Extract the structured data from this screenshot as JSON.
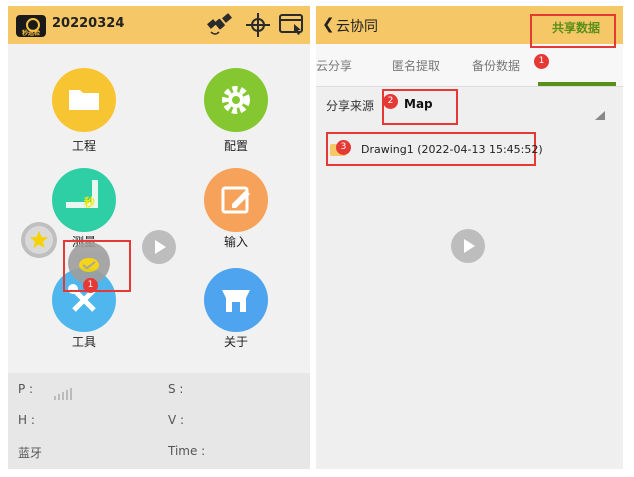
{
  "left": {
    "header": {
      "logo_text": "秒巡检",
      "project_name": "20220324",
      "icons": [
        "satellite-icon",
        "crosshair-icon",
        "screen-touch-icon"
      ]
    },
    "menu": [
      {
        "label": "工程",
        "icon": "folder-icon",
        "color": "#f7c531"
      },
      {
        "label": "配置",
        "icon": "gear-icon",
        "color": "#85c730"
      },
      {
        "label": "测量",
        "icon": "measure-icon",
        "color": "#2ecfa4"
      },
      {
        "label": "输入",
        "icon": "edit-icon",
        "color": "#f6a25a"
      },
      {
        "label": "工具",
        "icon": "tools-icon",
        "color": "#4fb7ee"
      },
      {
        "label": "关于",
        "icon": "about-icon",
        "color": "#4ea4ee"
      }
    ],
    "floating": {
      "star_icon": "star-icon",
      "cloud_icon": "cloud-icon",
      "play_icon": "play-icon",
      "badge": "1",
      "measure_badge": "秒"
    },
    "status": {
      "p_label": "P :",
      "s_label": "S :",
      "h_label": "H :",
      "v_label": "V :",
      "bt_label": "蓝牙",
      "time_label": "Time :"
    }
  },
  "right": {
    "header": {
      "back_icon": "chevron-left-icon",
      "title": "云协同"
    },
    "tabs": [
      "云分享",
      "匿名提取",
      "备份数据",
      "共享数据"
    ],
    "active_tab": 3,
    "badges": [
      "1",
      "2",
      "3"
    ],
    "source_label": "分享来源",
    "source_value": "Map",
    "files": [
      {
        "name": "Drawing1 (2022-04-13 15:45:52)"
      }
    ],
    "accent": "#5a8f1a",
    "highlight": "#e53935"
  }
}
